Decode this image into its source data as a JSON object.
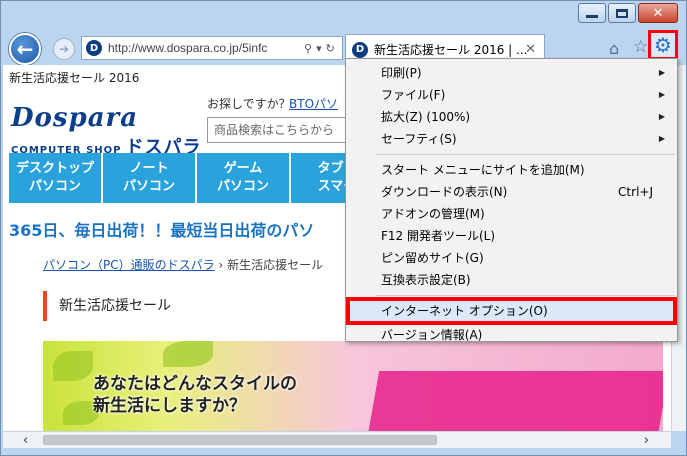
{
  "browser": {
    "url": "http://www.dospara.co.jp/5infc",
    "tab_title": "新生活応援セール 2016 | ...",
    "site_icon_letter": "D"
  },
  "page": {
    "title": "新生活応援セール 2016",
    "logo_main": "Dospara",
    "logo_sub": "COMPUTER SHOP",
    "logo_kana": "ドスパラ",
    "search_prompt": "お探しですか？",
    "bto_link": "BTOパソ",
    "search_placeholder": "商品検索はこちらから",
    "nav": [
      {
        "line1": "デスクトップ",
        "line2": "パソコン"
      },
      {
        "line1": "ノート",
        "line2": "パソコン"
      },
      {
        "line1": "ゲーム",
        "line2": "パソコン"
      },
      {
        "line1": "タブレ",
        "line2": "スマー"
      }
    ],
    "headline": "365日、毎日出荷！！最短当日出荷のパソ",
    "breadcrumb_link": "パソコン（PC）通販のドスパラ",
    "breadcrumb_sep": "›",
    "breadcrumb_current": "新生活応援セール",
    "section_heading": "新生活応援セール",
    "banner_line1": "あなたはどんなスタイルの",
    "banner_line2": "新生活にしますか？"
  },
  "menu": {
    "items": [
      {
        "label": "印刷(P)",
        "submenu": true
      },
      {
        "label": "ファイル(F)",
        "submenu": true
      },
      {
        "label": "拡大(Z) (100%)",
        "submenu": true
      },
      {
        "label": "セーフティ(S)",
        "submenu": true
      },
      {
        "label": "スタート メニューにサイトを追加(M)"
      },
      {
        "label": "ダウンロードの表示(N)",
        "shortcut": "Ctrl+J"
      },
      {
        "label": "アドオンの管理(M)"
      },
      {
        "label": "F12 開発者ツール(L)"
      },
      {
        "label": "ピン留めサイト(G)"
      },
      {
        "label": "互換表示設定(B)"
      },
      {
        "label": "インターネット オプション(O)",
        "highlighted": true
      },
      {
        "label": "バージョン情報(A)"
      }
    ]
  },
  "colors": {
    "highlight_border": "#ff0000",
    "nav_blue": "#2aa3dc",
    "headline_blue": "#1a73c4"
  }
}
